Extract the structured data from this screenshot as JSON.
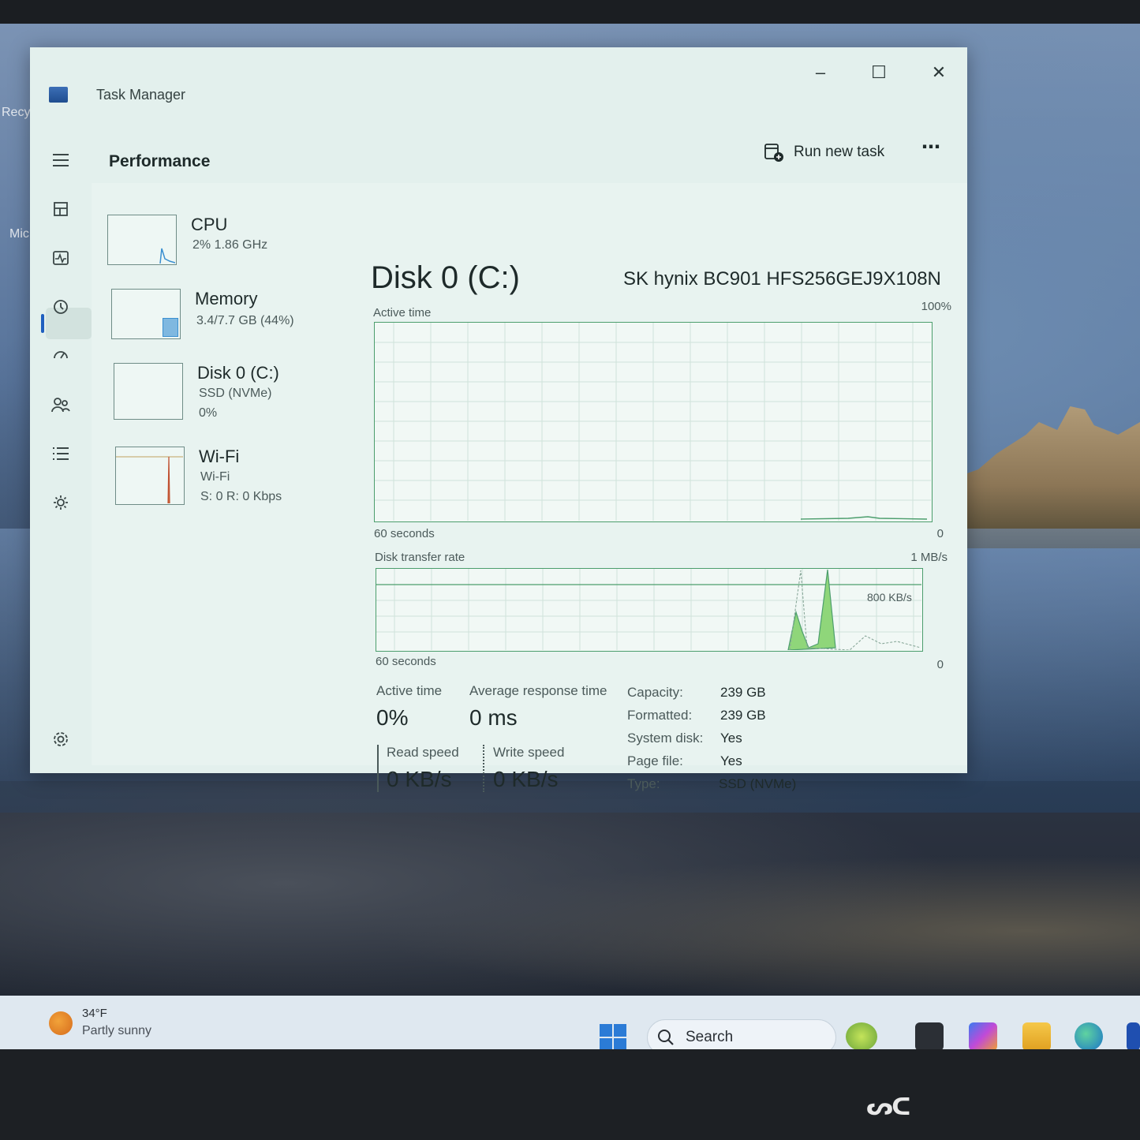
{
  "desktop": {
    "icon_labels": [
      "Recy",
      "Mic"
    ]
  },
  "window": {
    "title": "Task Manager",
    "controls": {
      "minimize": "–",
      "maximize": "☐",
      "close": "✕"
    }
  },
  "header": {
    "title": "Performance",
    "run_new_task": "Run new task",
    "more": "⋯"
  },
  "nav": {
    "icons": [
      "menu-icon",
      "processes-icon",
      "performance-icon",
      "app-history-icon",
      "startup-apps-icon",
      "users-icon",
      "details-icon",
      "services-icon",
      "settings-icon"
    ],
    "active": "performance-icon"
  },
  "devices": [
    {
      "name": "CPU",
      "sub1": "2%  1.86 GHz",
      "sub2": ""
    },
    {
      "name": "Memory",
      "sub1": "3.4/7.7 GB (44%)",
      "sub2": ""
    },
    {
      "name": "Disk 0 (C:)",
      "sub1": "SSD (NVMe)",
      "sub2": "0%"
    },
    {
      "name": "Wi-Fi",
      "sub1": "Wi-Fi",
      "sub2": "S: 0 R: 0 Kbps"
    }
  ],
  "disk": {
    "title": "Disk 0 (C:)",
    "model": "SK hynix BC901 HFS256GEJ9X108N",
    "active_chart": {
      "label": "Active time",
      "max_label": "100%",
      "x_label": "60 seconds",
      "x_end_label": "0"
    },
    "transfer_chart": {
      "label": "Disk transfer rate",
      "max_label": "1 MB/s",
      "ref_label": "800 KB/s",
      "x_label": "60 seconds",
      "x_end_label": "0"
    },
    "stats": {
      "active_time_label": "Active time",
      "active_time_value": "0%",
      "avg_response_label": "Average response time",
      "avg_response_value": "0 ms",
      "read_speed_label": "Read speed",
      "read_speed_value": "0 KB/s",
      "write_speed_label": "Write speed",
      "write_speed_value": "0 KB/s"
    },
    "properties": [
      {
        "key": "Capacity:",
        "value": "239 GB"
      },
      {
        "key": "Formatted:",
        "value": "239 GB"
      },
      {
        "key": "System disk:",
        "value": "Yes"
      },
      {
        "key": "Page file:",
        "value": "Yes"
      },
      {
        "key": "Type:",
        "value": "SSD (NVMe)"
      }
    ]
  },
  "taskbar": {
    "weather_temp": "34°F",
    "weather_desc": "Partly sunny",
    "search_placeholder": "Search"
  },
  "colors": {
    "window_bg": "#e3f0ed",
    "chart_border": "#4c9e6d",
    "chart_fill": "#8fd67a",
    "accent": "#1f5fbf"
  }
}
